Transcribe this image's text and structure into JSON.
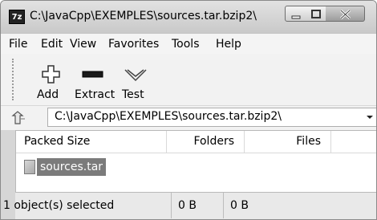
{
  "window": {
    "app_icon_text": "7z",
    "title": "C:\\JavaCpp\\EXEMPLES\\sources.tar.bzip2\\"
  },
  "menu": [
    "File",
    "Edit",
    "View",
    "Favorites",
    "Tools",
    "Help"
  ],
  "toolbar": {
    "add_label": "Add",
    "extract_label": "Extract",
    "test_label": "Test"
  },
  "address": {
    "path": "C:\\JavaCpp\\EXEMPLES\\sources.tar.bzip2\\"
  },
  "list": {
    "columns": [
      "Packed Size",
      "Folders",
      "Files"
    ],
    "items": [
      {
        "name": "sources.tar",
        "selected": true
      }
    ]
  },
  "status": {
    "selection": "1 object(s) selected",
    "size": "0 B",
    "packed_size": "0 B"
  }
}
